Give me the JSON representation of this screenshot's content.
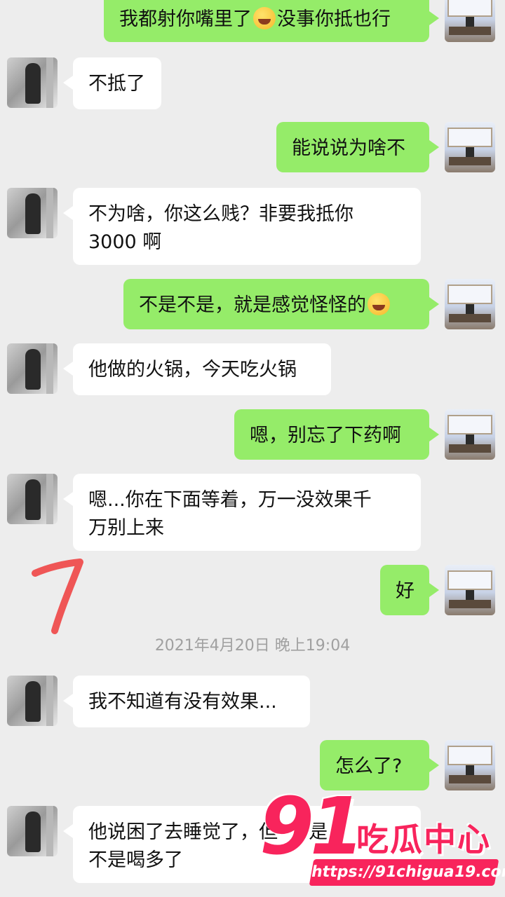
{
  "messages": [
    {
      "side": "right",
      "text_before": "我都射你嘴里了",
      "emoji": "laugh-cry-emoji",
      "text_after": "没事你抵也行"
    },
    {
      "side": "left",
      "text": "不抵了"
    },
    {
      "side": "right",
      "text": "能说说为啥不"
    },
    {
      "side": "left",
      "line1": "不为啥，你这么贱？非要我抵你",
      "line2": "3000 啊"
    },
    {
      "side": "right",
      "text_before": "不是不是，就是感觉怪怪的",
      "emoji": "laugh-cry-emoji"
    },
    {
      "side": "left",
      "text": "他做的火锅，今天吃火锅"
    },
    {
      "side": "right",
      "text": "嗯，别忘了下药啊"
    },
    {
      "side": "left",
      "line1": "嗯...你在下面等着，万一没效果千",
      "line2": "万别上来"
    },
    {
      "side": "right",
      "text": "好"
    },
    {
      "side": "left",
      "text": "我不知道有没有效果..."
    },
    {
      "side": "right",
      "text": "怎么了?"
    },
    {
      "side": "left",
      "line1": "他说困了去睡觉了，但 不 是",
      "line2": "不是喝多了"
    }
  ],
  "timestamp": "2021年4月20日 晚上19:04",
  "annotation": "7",
  "watermark": {
    "logo": "91",
    "name": "吃瓜中心",
    "url": "https://91chigua19.com"
  }
}
